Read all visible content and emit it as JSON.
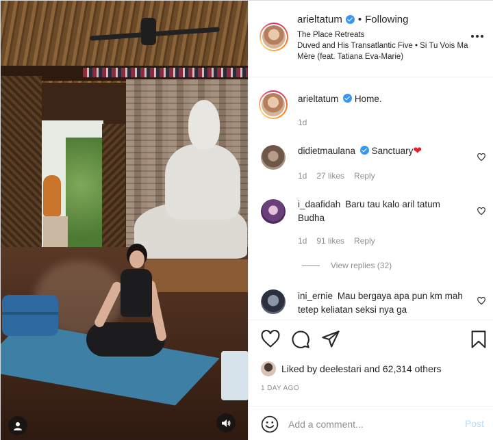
{
  "header": {
    "username": "arieltatum",
    "separator": "•",
    "follow_status": "Following",
    "location": "The Place Retreats",
    "audio": "Duved and His Transatlantic Five • Si Tu Vois Ma Mère (feat. Tatiana Eva-Marie)"
  },
  "caption": {
    "username": "arieltatum",
    "text": "Home.",
    "time": "1d"
  },
  "comments": [
    {
      "username": "didietmaulana",
      "verified": true,
      "text": "Sanctuary",
      "emoji": "❤",
      "time": "1d",
      "likes": "27 likes",
      "reply": "Reply"
    },
    {
      "username": "i_daafidah",
      "verified": false,
      "text": "Baru tau kalo aril tatum Budha",
      "time": "1d",
      "likes": "91 likes",
      "reply": "Reply",
      "view_replies": "View replies (32)"
    },
    {
      "username": "ini_ernie",
      "verified": false,
      "text": "Mau bergaya apa pun km mah tetep keliatan seksi nya ga"
    }
  ],
  "likes": {
    "prefix": "Liked by",
    "user": "deelestari",
    "conjunction": "and",
    "others": "62,314 others"
  },
  "timestamp": "1 DAY AGO",
  "add_comment": {
    "placeholder": "Add a comment...",
    "post_label": "Post"
  },
  "icons": {
    "more": "more-options-icon",
    "like": "heart-icon",
    "comment": "comment-icon",
    "share": "paper-plane-icon",
    "save": "bookmark-icon",
    "emoji": "smiley-icon",
    "user": "user-icon",
    "sound": "speaker-icon"
  },
  "colors": {
    "verified": "#3897f0",
    "text": "#262626",
    "muted": "#8e8e8e",
    "post_disabled": "#b3dbff",
    "heart_emoji": "#e0242b"
  }
}
